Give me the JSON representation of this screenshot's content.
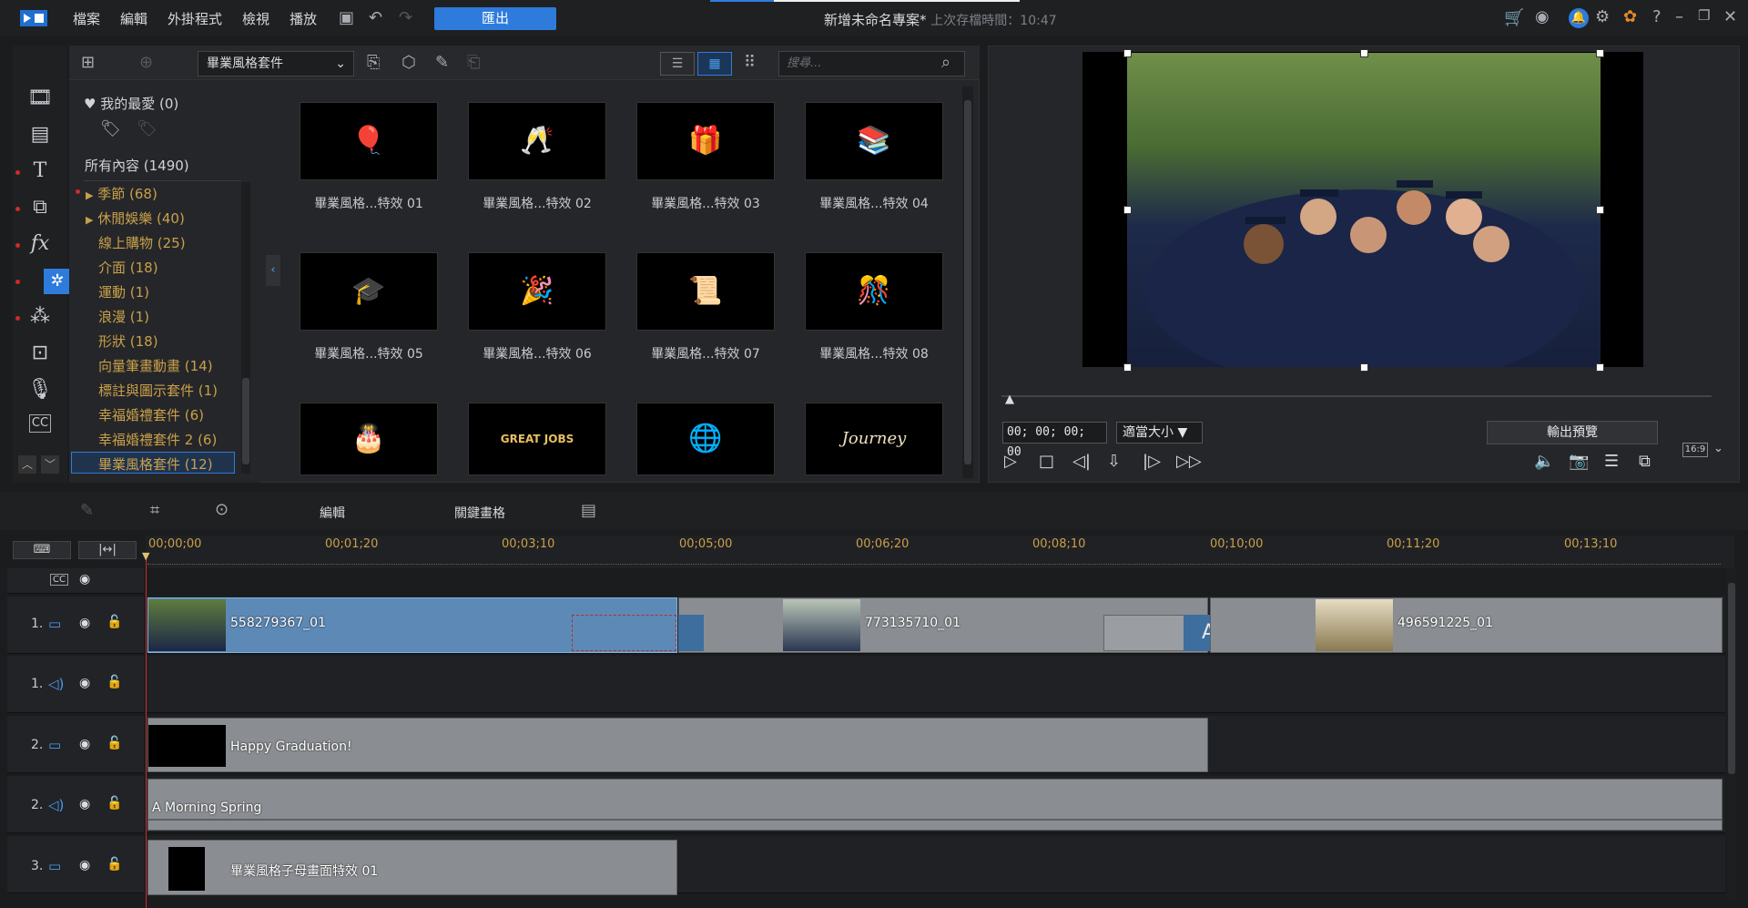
{
  "menu": [
    "檔案",
    "編輯",
    "外掛程式",
    "檢視",
    "播放"
  ],
  "export_label": "匯出",
  "window_title": "新增未命名專案*",
  "last_saved": "上次存檔時間：10:47",
  "library": {
    "dropdown": "畢業風格套件",
    "search_placeholder": "搜尋...",
    "favorites": "我的最愛 (0)",
    "all_content": "所有內容 (1490)",
    "categories": [
      {
        "label": "季節  (68)",
        "expand": true
      },
      {
        "label": "休閒娛樂  (40)",
        "expand": true
      },
      {
        "label": "線上購物  (25)"
      },
      {
        "label": "介面  (18)"
      },
      {
        "label": "運動  (1)"
      },
      {
        "label": "浪漫  (1)"
      },
      {
        "label": "形狀  (18)"
      },
      {
        "label": "向量筆畫動畫  (14)"
      },
      {
        "label": "標註與圖示套件  (1)"
      },
      {
        "label": "幸福婚禮套件  (6)"
      },
      {
        "label": "幸福婚禮套件 2  (6)"
      },
      {
        "label": "畢業風格套件  (12)",
        "selected": true
      }
    ],
    "thumbs": [
      {
        "label": "畢業風格...特效 01",
        "glyph": "🎈"
      },
      {
        "label": "畢業風格...特效 02",
        "glyph": "🥂"
      },
      {
        "label": "畢業風格...特效 03",
        "glyph": "🎁"
      },
      {
        "label": "畢業風格...特效 04",
        "glyph": "📚"
      },
      {
        "label": "畢業風格...特效 05",
        "glyph": "🎓"
      },
      {
        "label": "畢業風格...特效 06",
        "glyph": "🎉"
      },
      {
        "label": "畢業風格...特效 07",
        "glyph": "📜"
      },
      {
        "label": "畢業風格...特效 08",
        "glyph": "🎊"
      },
      {
        "label": "",
        "glyph": "🎂"
      },
      {
        "label": "",
        "glyph": "GREAT JOBS"
      },
      {
        "label": "",
        "glyph": "🌐"
      },
      {
        "label": "",
        "glyph": "Journey"
      }
    ]
  },
  "preview": {
    "timecode": "00; 00; 00; 00",
    "fit": "適當大小",
    "output_preview": "輸出預覽",
    "ratio": "16:9"
  },
  "editbar": {
    "edit": "編輯",
    "keyframe": "關鍵畫格"
  },
  "ruler": [
    "00;00;00",
    "00;01;20",
    "00;03;10",
    "00;05;00",
    "00;06;20",
    "00;08;10",
    "00;10;00",
    "00;11;20",
    "00;13;10"
  ],
  "tracks": [
    {
      "num": "1.",
      "type": "video"
    },
    {
      "num": "1.",
      "type": "audio"
    },
    {
      "num": "2.",
      "type": "video"
    },
    {
      "num": "2.",
      "type": "audio"
    },
    {
      "num": "3.",
      "type": "video"
    }
  ],
  "clips": {
    "v1a": "558279367_01",
    "v1b": "773135710_01",
    "v1c": "496591225_01",
    "v2": "Happy Graduation!",
    "a2": "A Morning Spring",
    "v3": "畢業風格子母畫面特效 01"
  }
}
